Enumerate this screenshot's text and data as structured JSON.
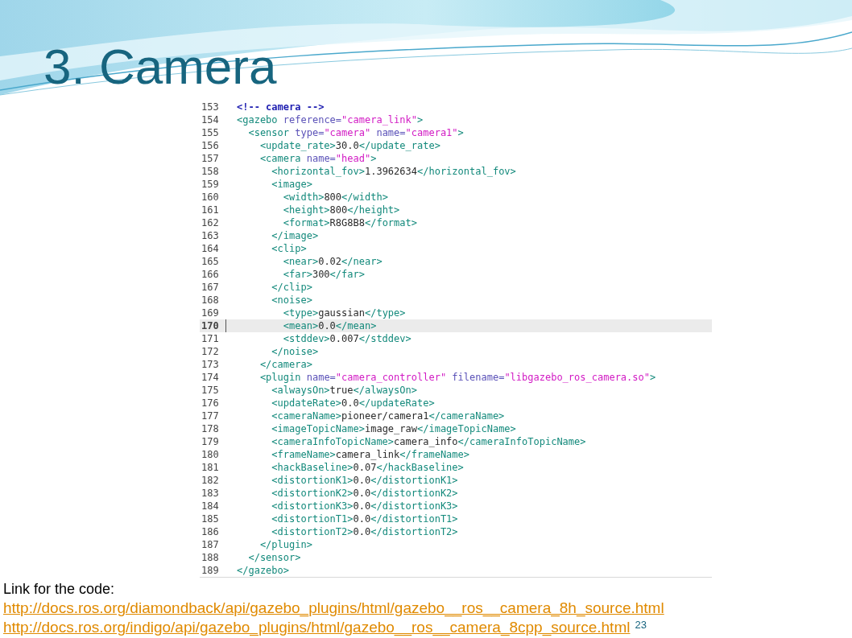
{
  "title": "3. Camera",
  "code": {
    "lines": [
      {
        "number": "153",
        "selected": false,
        "tokens": [
          {
            "kind": "comment",
            "text": "<!-- camera -->"
          }
        ]
      },
      {
        "number": "154",
        "selected": false,
        "tokens": [
          {
            "kind": "tag",
            "text": "<gazebo"
          },
          {
            "kind": "attr",
            "text": " reference="
          },
          {
            "kind": "value",
            "text": "\"camera_link\""
          },
          {
            "kind": "tag",
            "text": ">"
          }
        ]
      },
      {
        "number": "155",
        "selected": false,
        "tokens": [
          {
            "kind": "tag",
            "text": "  <sensor"
          },
          {
            "kind": "attr",
            "text": " type="
          },
          {
            "kind": "value",
            "text": "\"camera\""
          },
          {
            "kind": "attr",
            "text": " name="
          },
          {
            "kind": "value",
            "text": "\"camera1\""
          },
          {
            "kind": "tag",
            "text": ">"
          }
        ]
      },
      {
        "number": "156",
        "selected": false,
        "tokens": [
          {
            "kind": "tag",
            "text": "    <update_rate>"
          },
          {
            "kind": "text",
            "text": "30.0"
          },
          {
            "kind": "tag",
            "text": "</update_rate>"
          }
        ]
      },
      {
        "number": "157",
        "selected": false,
        "tokens": [
          {
            "kind": "tag",
            "text": "    <camera"
          },
          {
            "kind": "attr",
            "text": " name="
          },
          {
            "kind": "value",
            "text": "\"head\""
          },
          {
            "kind": "tag",
            "text": ">"
          }
        ]
      },
      {
        "number": "158",
        "selected": false,
        "tokens": [
          {
            "kind": "tag",
            "text": "      <horizontal_fov>"
          },
          {
            "kind": "text",
            "text": "1.3962634"
          },
          {
            "kind": "tag",
            "text": "</horizontal_fov>"
          }
        ]
      },
      {
        "number": "159",
        "selected": false,
        "tokens": [
          {
            "kind": "tag",
            "text": "      <image>"
          }
        ]
      },
      {
        "number": "160",
        "selected": false,
        "tokens": [
          {
            "kind": "tag",
            "text": "        <width>"
          },
          {
            "kind": "text",
            "text": "800"
          },
          {
            "kind": "tag",
            "text": "</width>"
          }
        ]
      },
      {
        "number": "161",
        "selected": false,
        "tokens": [
          {
            "kind": "tag",
            "text": "        <height>"
          },
          {
            "kind": "text",
            "text": "800"
          },
          {
            "kind": "tag",
            "text": "</height>"
          }
        ]
      },
      {
        "number": "162",
        "selected": false,
        "tokens": [
          {
            "kind": "tag",
            "text": "        <format>"
          },
          {
            "kind": "text",
            "text": "R8G8B8"
          },
          {
            "kind": "tag",
            "text": "</format>"
          }
        ]
      },
      {
        "number": "163",
        "selected": false,
        "tokens": [
          {
            "kind": "tag",
            "text": "      </image>"
          }
        ]
      },
      {
        "number": "164",
        "selected": false,
        "tokens": [
          {
            "kind": "tag",
            "text": "      <clip>"
          }
        ]
      },
      {
        "number": "165",
        "selected": false,
        "tokens": [
          {
            "kind": "tag",
            "text": "        <near>"
          },
          {
            "kind": "text",
            "text": "0.02"
          },
          {
            "kind": "tag",
            "text": "</near>"
          }
        ]
      },
      {
        "number": "166",
        "selected": false,
        "tokens": [
          {
            "kind": "tag",
            "text": "        <far>"
          },
          {
            "kind": "text",
            "text": "300"
          },
          {
            "kind": "tag",
            "text": "</far>"
          }
        ]
      },
      {
        "number": "167",
        "selected": false,
        "tokens": [
          {
            "kind": "tag",
            "text": "      </clip>"
          }
        ]
      },
      {
        "number": "168",
        "selected": false,
        "tokens": [
          {
            "kind": "tag",
            "text": "      <noise>"
          }
        ]
      },
      {
        "number": "169",
        "selected": false,
        "tokens": [
          {
            "kind": "tag",
            "text": "        <type>"
          },
          {
            "kind": "text",
            "text": "gaussian"
          },
          {
            "kind": "tag",
            "text": "</type>"
          }
        ]
      },
      {
        "number": "170",
        "selected": true,
        "tokens": [
          {
            "kind": "tag",
            "text": "        <mean>"
          },
          {
            "kind": "text",
            "text": "0.0"
          },
          {
            "kind": "tag",
            "text": "</mean>"
          }
        ]
      },
      {
        "number": "171",
        "selected": false,
        "tokens": [
          {
            "kind": "tag",
            "text": "        <stddev>"
          },
          {
            "kind": "text",
            "text": "0.007"
          },
          {
            "kind": "tag",
            "text": "</stddev>"
          }
        ]
      },
      {
        "number": "172",
        "selected": false,
        "tokens": [
          {
            "kind": "tag",
            "text": "      </noise>"
          }
        ]
      },
      {
        "number": "173",
        "selected": false,
        "tokens": [
          {
            "kind": "tag",
            "text": "    </camera>"
          }
        ]
      },
      {
        "number": "174",
        "selected": false,
        "tokens": [
          {
            "kind": "tag",
            "text": "    <plugin"
          },
          {
            "kind": "attr",
            "text": " name="
          },
          {
            "kind": "value",
            "text": "\"camera_controller\""
          },
          {
            "kind": "attr",
            "text": " filename="
          },
          {
            "kind": "value",
            "text": "\"libgazebo_ros_camera.so\""
          },
          {
            "kind": "tag",
            "text": ">"
          }
        ]
      },
      {
        "number": "175",
        "selected": false,
        "tokens": [
          {
            "kind": "tag",
            "text": "      <alwaysOn>"
          },
          {
            "kind": "text",
            "text": "true"
          },
          {
            "kind": "tag",
            "text": "</alwaysOn>"
          }
        ]
      },
      {
        "number": "176",
        "selected": false,
        "tokens": [
          {
            "kind": "tag",
            "text": "      <updateRate>"
          },
          {
            "kind": "text",
            "text": "0.0"
          },
          {
            "kind": "tag",
            "text": "</updateRate>"
          }
        ]
      },
      {
        "number": "177",
        "selected": false,
        "tokens": [
          {
            "kind": "tag",
            "text": "      <cameraName>"
          },
          {
            "kind": "text",
            "text": "pioneer/camera1"
          },
          {
            "kind": "tag",
            "text": "</cameraName>"
          }
        ]
      },
      {
        "number": "178",
        "selected": false,
        "tokens": [
          {
            "kind": "tag",
            "text": "      <imageTopicName>"
          },
          {
            "kind": "text",
            "text": "image_raw"
          },
          {
            "kind": "tag",
            "text": "</imageTopicName>"
          }
        ]
      },
      {
        "number": "179",
        "selected": false,
        "tokens": [
          {
            "kind": "tag",
            "text": "      <cameraInfoTopicName>"
          },
          {
            "kind": "text",
            "text": "camera_info"
          },
          {
            "kind": "tag",
            "text": "</cameraInfoTopicName>"
          }
        ]
      },
      {
        "number": "180",
        "selected": false,
        "tokens": [
          {
            "kind": "tag",
            "text": "      <frameName>"
          },
          {
            "kind": "text",
            "text": "camera_link"
          },
          {
            "kind": "tag",
            "text": "</frameName>"
          }
        ]
      },
      {
        "number": "181",
        "selected": false,
        "tokens": [
          {
            "kind": "tag",
            "text": "      <hackBaseline>"
          },
          {
            "kind": "text",
            "text": "0.07"
          },
          {
            "kind": "tag",
            "text": "</hackBaseline>"
          }
        ]
      },
      {
        "number": "182",
        "selected": false,
        "tokens": [
          {
            "kind": "tag",
            "text": "      <distortionK1>"
          },
          {
            "kind": "text",
            "text": "0.0"
          },
          {
            "kind": "tag",
            "text": "</distortionK1>"
          }
        ]
      },
      {
        "number": "183",
        "selected": false,
        "tokens": [
          {
            "kind": "tag",
            "text": "      <distortionK2>"
          },
          {
            "kind": "text",
            "text": "0.0"
          },
          {
            "kind": "tag",
            "text": "</distortionK2>"
          }
        ]
      },
      {
        "number": "184",
        "selected": false,
        "tokens": [
          {
            "kind": "tag",
            "text": "      <distortionK3>"
          },
          {
            "kind": "text",
            "text": "0.0"
          },
          {
            "kind": "tag",
            "text": "</distortionK3>"
          }
        ]
      },
      {
        "number": "185",
        "selected": false,
        "tokens": [
          {
            "kind": "tag",
            "text": "      <distortionT1>"
          },
          {
            "kind": "text",
            "text": "0.0"
          },
          {
            "kind": "tag",
            "text": "</distortionT1>"
          }
        ]
      },
      {
        "number": "186",
        "selected": false,
        "tokens": [
          {
            "kind": "tag",
            "text": "      <distortionT2>"
          },
          {
            "kind": "text",
            "text": "0.0"
          },
          {
            "kind": "tag",
            "text": "</distortionT2>"
          }
        ]
      },
      {
        "number": "187",
        "selected": false,
        "tokens": [
          {
            "kind": "tag",
            "text": "    </plugin>"
          }
        ]
      },
      {
        "number": "188",
        "selected": false,
        "tokens": [
          {
            "kind": "tag",
            "text": "  </sensor>"
          }
        ]
      },
      {
        "number": "189",
        "selected": false,
        "tokens": [
          {
            "kind": "tag",
            "text": "</gazebo>"
          }
        ]
      }
    ]
  },
  "footer": {
    "caption": "Link for the code:",
    "links": [
      "http://docs.ros.org/diamondback/api/gazebo_plugins/html/gazebo__ros__camera_8h_source.html",
      "http://docs.ros.org/indigo/api/gazebo_plugins/html/gazebo__ros__camera_8cpp_source.html"
    ],
    "page_number": "23"
  }
}
